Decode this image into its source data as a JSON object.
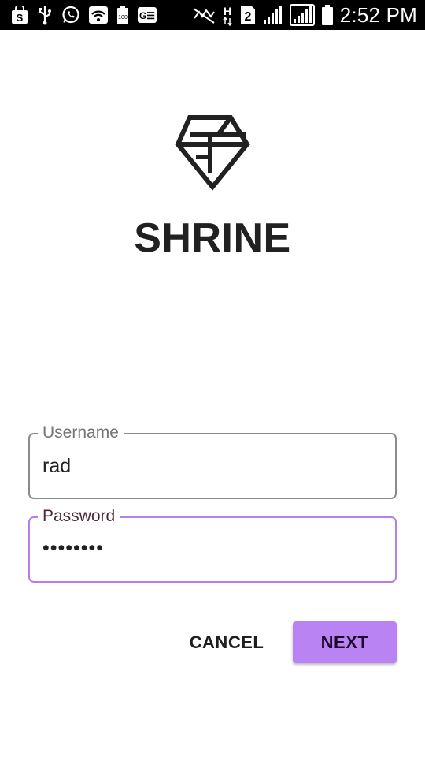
{
  "status_bar": {
    "time": "2:52 PM",
    "network_label": "H",
    "sim_slot": "2",
    "icons": [
      "shopping-bag-icon",
      "usb-icon",
      "whatsapp-icon",
      "wifi-icon",
      "battery-saver-icon",
      "ge-icon",
      "mute-icon",
      "network-h-icon",
      "sim2-icon",
      "signal-icon",
      "signal-icon",
      "battery-icon"
    ]
  },
  "brand": {
    "title": "SHRINE",
    "logo_icon": "diamond-icon"
  },
  "login": {
    "username_label": "Username",
    "username_value": "rad",
    "password_label": "Password",
    "password_value": "••••••••"
  },
  "actions": {
    "cancel_label": "CANCEL",
    "next_label": "NEXT"
  },
  "colors": {
    "accent": "#b983f3",
    "focused_border": "#b57ee8",
    "text": "#212121"
  }
}
